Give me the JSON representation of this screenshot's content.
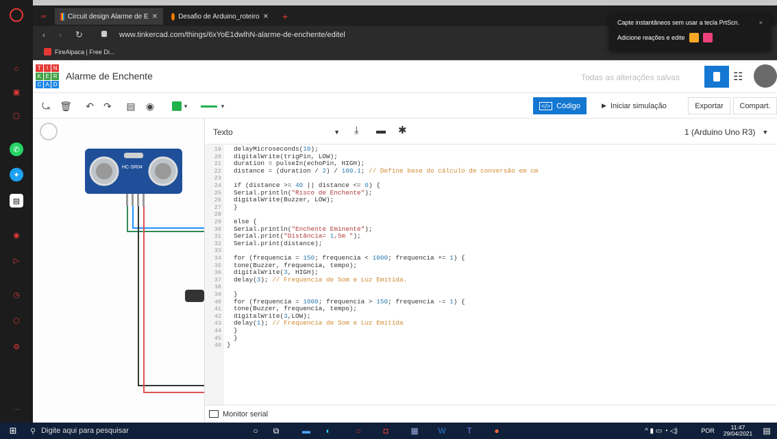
{
  "browser": {
    "tabs": [
      {
        "title": "Circuit design Alarme de E"
      },
      {
        "title": "Desafio de Arduino_roteiro"
      }
    ],
    "url": "www.tinkercad.com/things/6xYoE1dwlhN-alarme-de-enchente/editel",
    "bookmarks": [
      {
        "label": "FireAlpaca | Free Di..."
      }
    ],
    "notification": {
      "line1": "Capte instantâneos sem usar a tecla PrtScn.",
      "line2": "Adicione reações e edite",
      "close": "×"
    }
  },
  "tinkercad": {
    "logo_letters": [
      "T",
      "I",
      "N",
      "K",
      "E",
      "R",
      "C",
      "A",
      "D"
    ],
    "project_title": "Alarme de Enchente",
    "save_status": "Todas as alterações salvas",
    "buttons": {
      "code": "Código",
      "start_simulation": "Iniciar simulação",
      "export": "Exportar",
      "share": "Compart."
    },
    "code_toolbar": {
      "mode": "Texto",
      "device": "1 (Arduino Uno R3)"
    },
    "sensor_label": "HC-SR04",
    "serial_monitor": "Monitor serial"
  },
  "code": [
    {
      "n": "19",
      "text": "delayMicroseconds(10);"
    },
    {
      "n": "20",
      "text": "digitalWrite(trigPin, LOW);"
    },
    {
      "n": "21",
      "text": "duration = pulseIn(echoPin, HIGH);"
    },
    {
      "n": "22",
      "text": "distance = (duration / 2) / 100.1; // Define base do cálculo de conversão em cm"
    },
    {
      "n": "23",
      "text": ""
    },
    {
      "n": "24",
      "text": "if (distance >= 40 || distance <= 0) {"
    },
    {
      "n": "25",
      "text": "Serial.println(\"Risco de Enchente\");"
    },
    {
      "n": "26",
      "text": "digitalWrite(Buzzer, LOW);"
    },
    {
      "n": "27",
      "text": "}"
    },
    {
      "n": "28",
      "text": ""
    },
    {
      "n": "29",
      "text": "else {"
    },
    {
      "n": "30",
      "text": "Serial.println(\"Enchente Eminente\");"
    },
    {
      "n": "31",
      "text": "Serial.print(\"Distância= 1,5m \");"
    },
    {
      "n": "32",
      "text": "Serial.print(distance);"
    },
    {
      "n": "33",
      "text": ""
    },
    {
      "n": "34",
      "text": "for (frequencia = 150; frequencia < 1000; frequencia += 1) {"
    },
    {
      "n": "35",
      "text": "tone(Buzzer, frequencia, tempo);"
    },
    {
      "n": "36",
      "text": "digitalWrite(3, HIGH);"
    },
    {
      "n": "37",
      "text": "delay(3); // Frequencia de Som e Luz Emitida."
    },
    {
      "n": "38",
      "text": ""
    },
    {
      "n": "39",
      "text": "}"
    },
    {
      "n": "40",
      "text": "for (frequencia = 1000; frequencia > 150; frequencia -= 1) {"
    },
    {
      "n": "41",
      "text": "tone(Buzzer, frequencia, tempo);"
    },
    {
      "n": "42",
      "text": "digitalWrite(3,LOW);"
    },
    {
      "n": "43",
      "text": "delay(1); // Frequencia de Som e Luz Emitida"
    },
    {
      "n": "44",
      "text": "}"
    },
    {
      "n": "45",
      "text": "}"
    },
    {
      "n": "46",
      "text": "}"
    }
  ],
  "taskbar": {
    "search_placeholder": "Digite aqui para pesquisar",
    "language": "POR",
    "time": "11:47",
    "date": "29/04/2021"
  },
  "colors": {
    "accent_blue": "#1477d1",
    "sidebar_red": "#e53935",
    "code_comment": "#d08a30",
    "code_string": "#b03a3a"
  }
}
